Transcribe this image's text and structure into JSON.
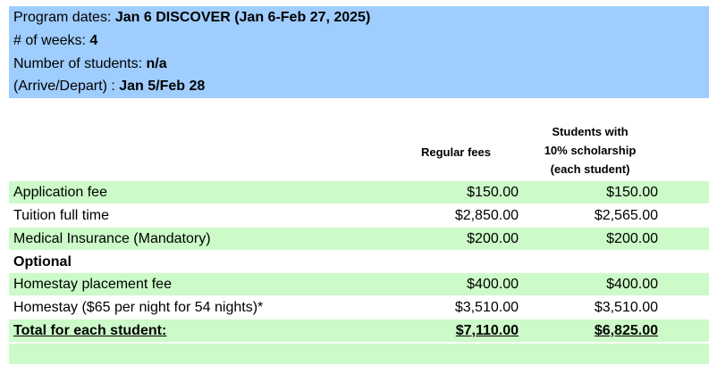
{
  "header": {
    "program_dates_label": "Program dates: ",
    "program_dates_value": "Jan 6 DISCOVER (Jan 6-Feb 27, 2025)",
    "weeks_label": "# of weeks: ",
    "weeks_value": "4",
    "students_label": "Number of students: ",
    "students_value": "n/a",
    "arrive_label": "(Arrive/Depart) : ",
    "arrive_value": "Jan 5/Feb 28"
  },
  "columns": {
    "regular": "Regular fees",
    "scholarship_line1": "Students with",
    "scholarship_line2": "10% scholarship",
    "scholarship_line3": "(each student)"
  },
  "rows": [
    {
      "label": "Application fee",
      "regular": "$150.00",
      "scholarship": "$150.00"
    },
    {
      "label": "Tuition full time",
      "regular": "$2,850.00",
      "scholarship": "$2,565.00"
    },
    {
      "label": "Medical Insurance (Mandatory)",
      "regular": "$200.00",
      "scholarship": "$200.00"
    },
    {
      "label": "Optional",
      "regular": "",
      "scholarship": ""
    },
    {
      "label": "Homestay placement fee",
      "regular": "$400.00",
      "scholarship": "$400.00"
    },
    {
      "label": "Homestay ($65 per night for 54 nights)*",
      "regular": "$3,510.00",
      "scholarship": "$3,510.00"
    },
    {
      "label": "Total for each student:",
      "regular": "$7,110.00",
      "scholarship": "$6,825.00"
    }
  ],
  "colors": {
    "header_bg": "#9fcdfd",
    "row_green": "#ccfac8"
  }
}
